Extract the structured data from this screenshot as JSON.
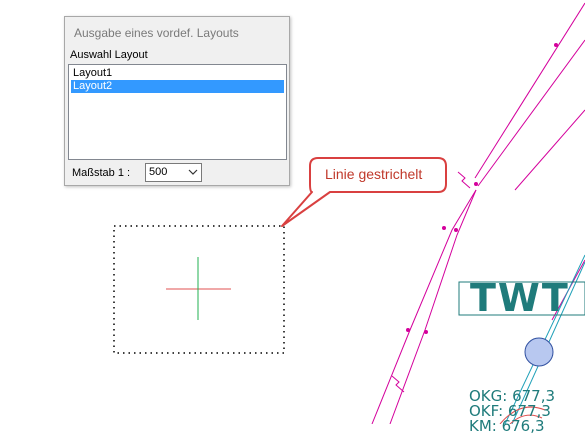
{
  "dialog": {
    "title": "Ausgabe eines vordef. Layouts",
    "group_label": "Auswahl Layout",
    "layouts": [
      {
        "label": "Layout1",
        "selected": false
      },
      {
        "label": "Layout2",
        "selected": true
      }
    ],
    "scale_label": "Maßstab 1 :",
    "scale_value": "500"
  },
  "canvas": {
    "callout_text": "Linie gestrichelt",
    "twt_label": "TWT",
    "okg_lines": [
      "OKG: 677,3",
      "OKF: 677,3",
      "KM: 676,3"
    ],
    "colors": {
      "callout_red": "#d94040",
      "line_magenta": "#d4009c",
      "pipe_cyan": "#1fa0b8",
      "text_teal": "#1f7b7b",
      "cross_red": "#e05050",
      "cross_green": "#20b050",
      "selection_blue": "#3399ff"
    }
  }
}
